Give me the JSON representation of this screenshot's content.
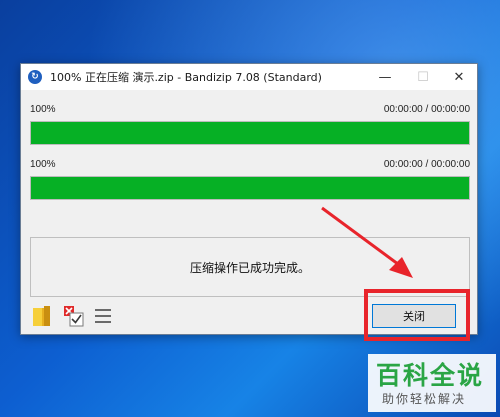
{
  "window": {
    "title": "100% 正在压缩 演示.zip - Bandizip 7.08 (Standard)",
    "minimize_glyph": "—",
    "maximize_glyph": "☐",
    "close_glyph": "✕"
  },
  "progress": [
    {
      "percent_label": "100%",
      "time": "00:00:00 / 00:00:00",
      "fill_fraction": 1.0
    },
    {
      "percent_label": "100%",
      "time": "00:00:00 / 00:00:00",
      "fill_fraction": 1.0
    }
  ],
  "status": {
    "message": "压缩操作已成功完成。"
  },
  "toolbar": {
    "icons": [
      "folder-icon",
      "checklist-icon",
      "menu-icon"
    ],
    "close_label": "关闭"
  },
  "watermark": {
    "main": "百科全说",
    "sub": "助你轻松解决"
  },
  "colors": {
    "progress_green": "#06b025",
    "highlight_red": "#e8242b",
    "accent_blue": "#0078d7",
    "watermark_green": "#2aa545"
  }
}
